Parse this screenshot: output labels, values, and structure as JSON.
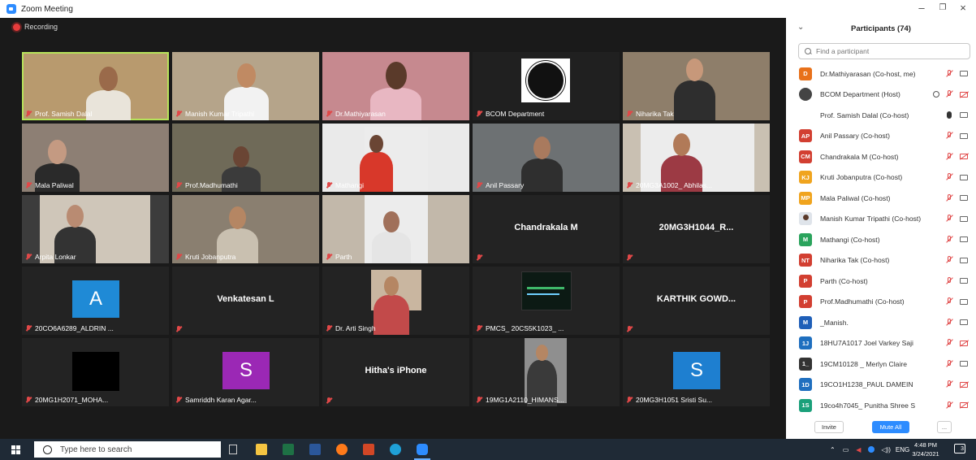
{
  "window": {
    "title": "Zoom Meeting"
  },
  "recording": {
    "label": "Recording"
  },
  "tiles": [
    {
      "label": "Prof. Samish Dalal"
    },
    {
      "label": "Manish Kumar Tripathi"
    },
    {
      "label": "Dr.Mathiyarasan"
    },
    {
      "label": "BCOM Department"
    },
    {
      "label": "Niharika Tak"
    },
    {
      "label": "Mala Paliwal"
    },
    {
      "label": "Prof.Madhumathi"
    },
    {
      "label": "Mathangi"
    },
    {
      "label": "Anil Passary"
    },
    {
      "label": "20MG3A1002_ Abhilas..."
    },
    {
      "label": "Arpita Lonkar"
    },
    {
      "label": "Kruti Jobanputra"
    },
    {
      "label": "Parth"
    },
    {
      "label": "",
      "big": "Chandrakala M"
    },
    {
      "label": "",
      "big": "20MG3H1044_R..."
    },
    {
      "label": "20CO6A6289_ALDRIN ...",
      "avatar": "A"
    },
    {
      "label": "",
      "big": "Venkatesan L"
    },
    {
      "label": "Dr. Arti Singh"
    },
    {
      "label": "PMCS_ 20CS5K1023_ ..."
    },
    {
      "label": "",
      "big": "KARTHIK GOWD..."
    },
    {
      "label": "20MG1H2071_MOHA..."
    },
    {
      "label": "Samriddh Karan Agar...",
      "avatar": "S"
    },
    {
      "label": "",
      "big": "Hitha's iPhone"
    },
    {
      "label": "19MG1A2110_HIMANS..."
    },
    {
      "label": "20MG3H1051 Sristi Su...",
      "avatar": "S"
    }
  ],
  "panel": {
    "title": "Participants (74)",
    "search_placeholder": "Find a participant",
    "participants": [
      {
        "initials": "D",
        "name": "Dr.Mathiyarasan (Co-host, me)",
        "color": "#e8711a"
      },
      {
        "initials": "",
        "name": "BCOM Department (Host)",
        "color": "#444444"
      },
      {
        "initials": "",
        "name": "Prof. Samish Dalal (Co-host)",
        "color": "#ffffff"
      },
      {
        "initials": "AP",
        "name": "Anil Passary (Co-host)",
        "color": "#d23f31"
      },
      {
        "initials": "CM",
        "name": "Chandrakala M (Co-host)",
        "color": "#d23f31"
      },
      {
        "initials": "KJ",
        "name": "Kruti Jobanputra (Co-host)",
        "color": "#f0a41e"
      },
      {
        "initials": "MP",
        "name": "Mala Paliwal (Co-host)",
        "color": "#f0a41e"
      },
      {
        "initials": "",
        "name": "Manish Kumar Tripathi (Co-host)",
        "color": "#6b7a8f"
      },
      {
        "initials": "M",
        "name": "Mathangi (Co-host)",
        "color": "#2aa35c"
      },
      {
        "initials": "NT",
        "name": "Niharika Tak (Co-host)",
        "color": "#d23f31"
      },
      {
        "initials": "P",
        "name": "Parth (Co-host)",
        "color": "#d23f31"
      },
      {
        "initials": "P",
        "name": "Prof.Madhumathi (Co-host)",
        "color": "#d23f31"
      },
      {
        "initials": "M",
        "name": "_Manish.",
        "color": "#1f5fb8"
      },
      {
        "initials": "1J",
        "name": "18HU7A1017 Joel Varkey Saji",
        "color": "#1f6fbf"
      },
      {
        "initials": "1_",
        "name": "19CM10128 _ Merlyn Claire",
        "color": "#333333"
      },
      {
        "initials": "1D",
        "name": "19CO1H1238_PAUL DAMEIN",
        "color": "#1f6fbf"
      },
      {
        "initials": "1S",
        "name": "19co4h7045_ Punitha Shree S",
        "color": "#1aa07a"
      }
    ],
    "invite_label": "Invite",
    "mute_all_label": "Mute All",
    "more_label": "..."
  },
  "taskbar": {
    "search_placeholder": "Type here to search",
    "lang": "ENG",
    "time": "4:48 PM",
    "date": "3/24/2021",
    "notif": "3"
  },
  "colors": {
    "accent": "#2d8cff",
    "mic_muted": "#e04848",
    "active_border": "#b6e35a"
  }
}
